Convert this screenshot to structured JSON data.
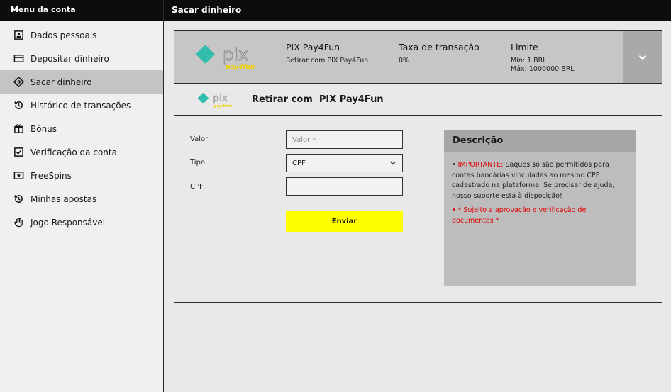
{
  "sidebar": {
    "title": "Menu da conta",
    "items": [
      {
        "label": "Dados pessoais",
        "icon": "id-card-icon"
      },
      {
        "label": "Depositar dinheiro",
        "icon": "card-icon"
      },
      {
        "label": "Sacar dinheiro",
        "icon": "withdraw-icon"
      },
      {
        "label": "Histórico de transações",
        "icon": "history-icon"
      },
      {
        "label": "Bônus",
        "icon": "gift-icon"
      },
      {
        "label": "Verificação da conta",
        "icon": "checkbox-icon"
      },
      {
        "label": "FreeSpins",
        "icon": "ticket-icon"
      },
      {
        "label": "Minhas apostas",
        "icon": "history-icon"
      },
      {
        "label": "Jogo Responsável",
        "icon": "hand-icon"
      }
    ],
    "active_index": 2
  },
  "header": {
    "title": "Sacar dinheiro"
  },
  "method": {
    "name": "PIX Pay4Fun",
    "subtitle": "Retirar com PIX Pay4Fun",
    "fee_label": "Taxa de transação",
    "fee_value": "0%",
    "limit_label": "Limite",
    "limit_min": "Mín: 1 BRL",
    "limit_max": "Máx: 1000000 BRL",
    "logo_text": "pix",
    "logo_sub": "pay4fun"
  },
  "form": {
    "title": "Retirar com  PIX Pay4Fun",
    "valor_label": "Valor",
    "valor_placeholder": "Valor *",
    "tipo_label": "Tipo",
    "tipo_value": "CPF",
    "cpf_label": "CPF",
    "cpf_value": "",
    "submit_label": "Enviar"
  },
  "description": {
    "title": "Descrição",
    "important_label": "IMPORTANTE:",
    "important_text": " Saques só são permitidos para contas bancárias vinculadas ao mesmo CPF cadastrado na plataforma. Se precisar de ajuda, nosso suporte está à disposição!",
    "note": "* Sujeito a aprovação e verificação de documentos *"
  },
  "colors": {
    "accent": "#ffff00",
    "pix_green": "#32bcad",
    "warning": "#e00000"
  }
}
